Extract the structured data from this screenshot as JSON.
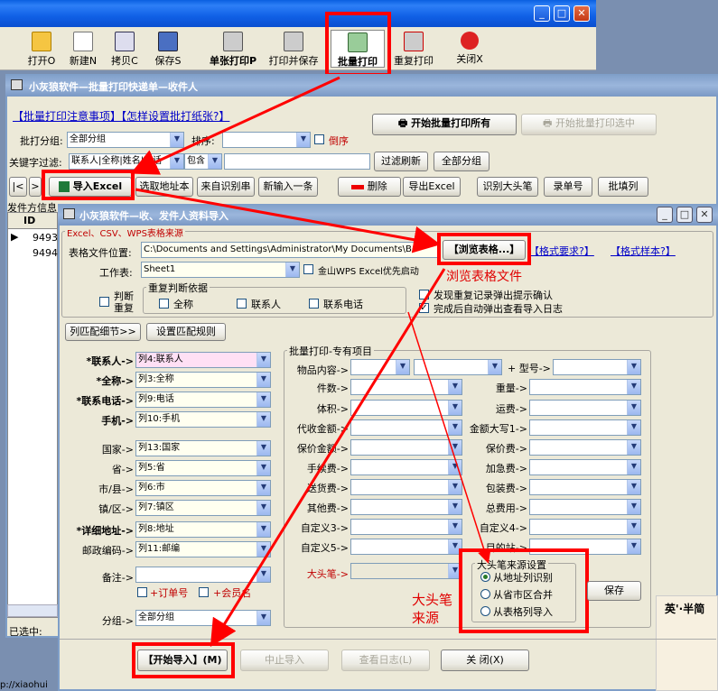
{
  "toolbar": {
    "open": "打开O",
    "new": "新建N",
    "copy": "拷贝C",
    "save": "保存S",
    "single_print": "单张打印P",
    "print_save": "打印并保存",
    "batch_print": "批量打印",
    "reprint": "重复打印",
    "close": "关闭X"
  },
  "batch_window": {
    "title": "小灰狼软件—批量打印快递单—收件人",
    "notice_link": "【批量打印注意事项】【怎样设置批打纸张?】",
    "group_label": "批打分组:",
    "group_value": "全部分组",
    "sort_label": "排序:",
    "reverse_label": "倒序",
    "filter_label": "关键字过滤:",
    "filter_field": "联系人|全称|姓名|电话",
    "filter_op": "包含",
    "filter_refresh": "过滤刷新",
    "all_groups": "全部分组",
    "start_all": "开始批量打印所有",
    "start_selected": "开始批量打印选中",
    "nav_first": "|<",
    "nav_next": ">",
    "import_excel": "导入Excel",
    "pick_address": "选取地址本",
    "auto_recognize": "来自识别串",
    "new_entry": "新输入一条",
    "delete": "删除",
    "export_excel": "导出Excel",
    "big_head": "识别大头笔",
    "record_no": "录单号",
    "batch_fill": "批填列",
    "left_label_fragment": "发件方信息",
    "table_header": "ID",
    "rows": [
      "9493",
      "9494"
    ],
    "selected_label": "已选中:",
    "url_fragment": "p://xiaohui"
  },
  "import_dialog": {
    "title": "小灰狼软件—收、发件人资料导入",
    "source_title": "Excel、CSV、WPS表格来源",
    "file_label": "表格文件位置:",
    "file_path": "C:\\Documents and Settings\\Administrator\\My Documents\\B",
    "browse": "【浏览表格...】",
    "format_req": "【格式要求?】",
    "format_sample": "【格式样本?】",
    "sheet_label": "工作表:",
    "sheet_value": "Sheet1",
    "wps_priority": "金山WPS Excel优先启动",
    "judge_dup": "判断重复",
    "dup_basis_title": "重复判断依据",
    "dup_name": "全称",
    "dup_contact": "联系人",
    "dup_phone": "联系电话",
    "prompt_dup": "发现重复记录弹出提示确认",
    "show_log": "完成后自动弹出查看导入日志",
    "col_match_btn": "列匹配细节>>",
    "set_rules_btn": "设置匹配规则",
    "fields": [
      {
        "label": "*联系人->",
        "value": "列4:联系人",
        "bold": true,
        "pink": true
      },
      {
        "label": "*全称->",
        "value": "列3:全称",
        "bold": true
      },
      {
        "label": "*联系电话->",
        "value": "列9:电话",
        "bold": true
      },
      {
        "label": "手机->",
        "value": "列10:手机",
        "bold": true
      },
      {
        "label": "国家->",
        "value": "列13:国家"
      },
      {
        "label": "省->",
        "value": "列5:省"
      },
      {
        "label": "市/县->",
        "value": "列6:市"
      },
      {
        "label": "镇/区->",
        "value": "列7:镇区"
      },
      {
        "label": "*详细地址->",
        "value": "列8:地址",
        "bold": true
      },
      {
        "label": "邮政编码->",
        "value": "列11:邮编"
      }
    ],
    "remark_label": "备注->",
    "add_tracking": "+订单号",
    "add_member": "+会员名",
    "group_label": "分组->",
    "group_value": "全部分组",
    "special_title": "批量打印-专有项目",
    "goods_label": "物品内容->",
    "model_label": "+ 型号->",
    "left_items": [
      "件数->",
      "体积->",
      "代收金额->",
      "保价金额->",
      "手续费->",
      "送货费->",
      "其他费->",
      "自定义3->",
      "自定义5->"
    ],
    "right_items": [
      "重量->",
      "运费->",
      "金额大写1->",
      "保价费->",
      "加急费->",
      "包装费->",
      "总费用->",
      "自定义4->",
      "目的站->"
    ],
    "big_pen_label": "大头笔->",
    "big_pen_src_title": "大头笔来源设置",
    "big_pen_opts": [
      "从地址列识别",
      "从省市区合并",
      "从表格列导入"
    ],
    "save": "保存",
    "start_import": "【开始导入】(M)",
    "stop_import": "中止导入",
    "view_log": "查看日志(L)",
    "close": "关 闭(X)"
  },
  "annotations": {
    "browse_note": "浏览表格文件",
    "big_pen_note_1": "大头笔",
    "big_pen_note_2": "来源"
  },
  "ad_text": "英'·半简"
}
